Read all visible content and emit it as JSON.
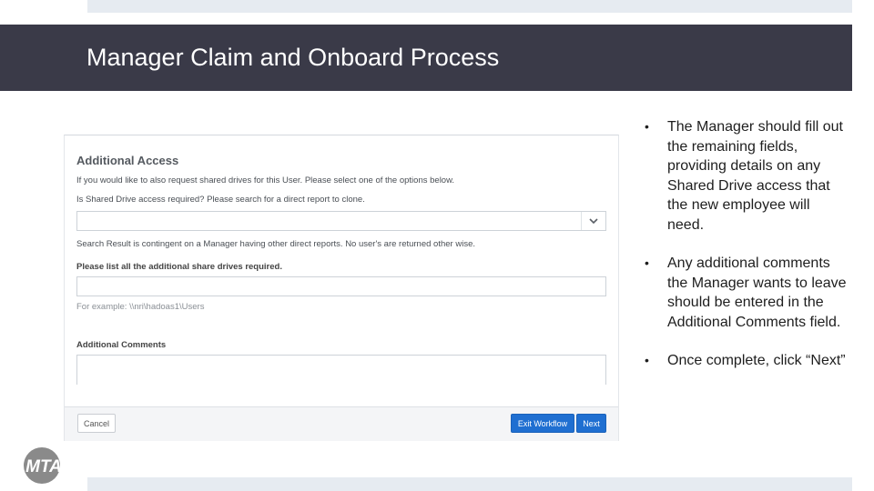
{
  "slide": {
    "title": "Manager Claim and Onboard Process"
  },
  "form": {
    "section_title": "Additional Access",
    "intro": "If you would like to also request shared drives for this User. Please select one of the options below.",
    "shared_drive_label": "Is Shared Drive access required? Please search for a direct report to clone.",
    "shared_drive_value": "",
    "search_note": "Search Result is contingent on a Manager having other direct reports. No user's are returned other wise.",
    "share_drives_label": "Please list all the additional share drives required.",
    "share_drives_value": "",
    "example_text": "For example: \\\\nri\\hadoas1\\Users",
    "comments_label": "Additional Comments",
    "comments_value": "",
    "buttons": {
      "cancel": "Cancel",
      "exit": "Exit Workflow",
      "next": "Next"
    }
  },
  "bullets": [
    "The Manager should fill out the remaining fields, providing details on any Shared Drive access that the new employee will need.",
    "Any additional comments the Manager wants to leave should be entered in the Additional Comments field.",
    "Once complete, click “Next”"
  ],
  "logo": {
    "text": "MTA",
    "color": "#8a8a8a"
  },
  "colors": {
    "title_bar": "#3a3a48",
    "accent_button": "#1f6fd1",
    "strip": "#e6ebf1"
  }
}
